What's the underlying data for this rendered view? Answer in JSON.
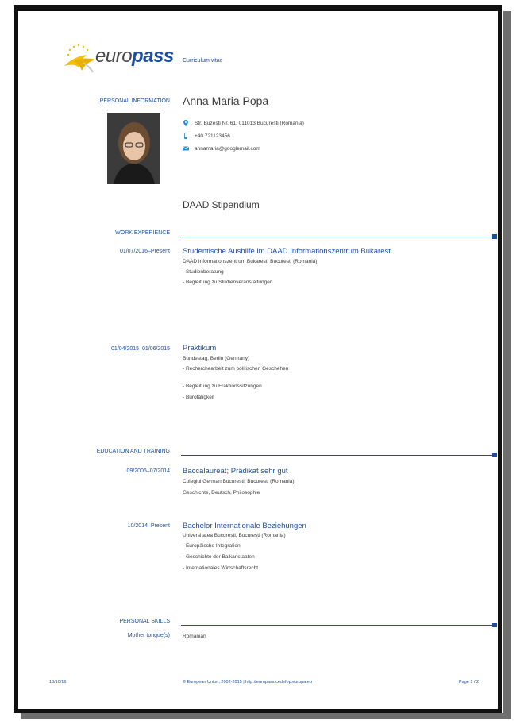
{
  "logo": {
    "prefix": "euro",
    "suffix": "pass"
  },
  "document_title": "Curriculum vitae",
  "personal_information": {
    "section_label": "PERSONAL INFORMATION",
    "name": "Anna Maria Popa",
    "address": "Str. Buzesti Nr. 61, 011013 Bucuresti (Romania)",
    "phone": "+40 721123456",
    "email": "annamaria@googlemail.com",
    "address_icon": "location-pin-icon",
    "phone_icon": "phone-icon",
    "email_icon": "envelope-icon"
  },
  "headline": "DAAD Stipendium",
  "work_experience": {
    "section_label": "WORK EXPERIENCE",
    "items": [
      {
        "dates": "01/07/2016–Present",
        "title": "Studentische Aushilfe im DAAD Informationszentrum Bukarest",
        "employer": "DAAD Informationszentrum Bukarest, Bucuresti (Romania)",
        "duties": [
          "- Studienberatung",
          "- Begleitung zu Studienveranstaltungen"
        ]
      },
      {
        "dates": "01/04/2015–01/06/2015",
        "title": "Praktikum",
        "employer": "Bundestag, Berlin (Germany)",
        "duties": [
          "- Recherchearbeit zum politischen Geschehen",
          "- Begleitung zu Fraktionssitzungen",
          "- Bürotätigkeit"
        ]
      }
    ]
  },
  "education": {
    "section_label": "EDUCATION AND TRAINING",
    "items": [
      {
        "dates": "09/2006–07/2014",
        "title": "Baccalaureat; Prädikat sehr gut",
        "institution": "Colegiul German Bucuresti, Bucuresti (Romania)",
        "details": [
          "Geschichte, Deutsch, Philosophie"
        ]
      },
      {
        "dates": "10/2014–Present",
        "title": "Bachelor Internationale Beziehungen",
        "institution": "Universitatea Bucuresti, Bucuresti (Romania)",
        "details": [
          "- Europäische Integration",
          "- Geschichte der Balkanstaaten",
          "- Internationales Wirtschaftsrecht"
        ]
      }
    ]
  },
  "personal_skills": {
    "section_label": "PERSONAL SKILLS",
    "mother_tongue_label": "Mother tongue(s)",
    "mother_tongue": "Romanian"
  },
  "footer": {
    "date": "13/10/16",
    "copyright": "© European Union, 2002-2015 | http://europass.cedefop.europa.eu",
    "page": "Page 1 / 2"
  },
  "colors": {
    "accent": "#1d4f9e",
    "text": "#3c3c3c",
    "logo_yellow": "#f2c200"
  }
}
